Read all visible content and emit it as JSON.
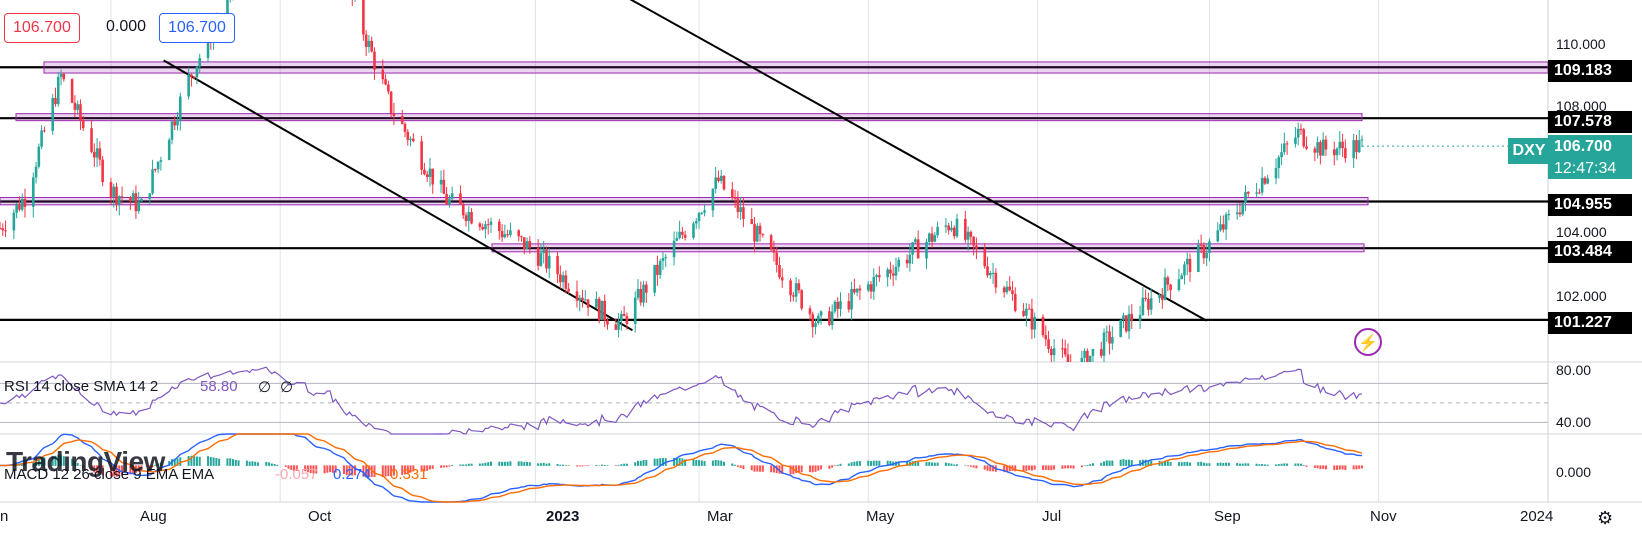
{
  "header": {
    "open_value": "106.700",
    "change_value": "0.000",
    "close_value": "106.700"
  },
  "symbol": {
    "ticker": "DXY",
    "last_price": "106.700",
    "countdown": "12:47:34"
  },
  "price_axis": {
    "ticks": [
      "110.000",
      "108.000",
      "104.000",
      "102.000"
    ]
  },
  "levels": [
    {
      "label": "109.183",
      "value": 109.183
    },
    {
      "label": "107.578",
      "value": 107.578
    },
    {
      "label": "104.955",
      "value": 104.955
    },
    {
      "label": "103.484",
      "value": 103.484
    },
    {
      "label": "101.227",
      "value": 101.227
    }
  ],
  "x_axis": {
    "labels": [
      "Aug",
      "Oct",
      "2023",
      "Mar",
      "May",
      "Jul",
      "Sep",
      "Nov",
      "2024"
    ],
    "first_label_fragment": "n"
  },
  "rsi": {
    "label": "RSI 14 close SMA 14 2",
    "value": "58.80",
    "extra1": "∅",
    "extra2": "∅",
    "axis_ticks": [
      "80.00",
      "40.00"
    ]
  },
  "macd": {
    "label": "MACD 12 26 close 9 EMA EMA",
    "histogram": "-0.057",
    "macd_value": "0.274",
    "signal_value": "0.331",
    "axis_tick": "0.000"
  },
  "branding": {
    "logo_text": "TradingView"
  },
  "colors": {
    "up": "#26a69a",
    "down": "#f23645",
    "zone": "#9c27b0",
    "rsi_line": "#7e57c2",
    "macd_line": "#2962ff",
    "signal_line": "#ff6d00"
  },
  "chart_data": {
    "type": "candlestick",
    "title": "DXY",
    "ylim": [
      99.9,
      111.3
    ],
    "x_range": [
      "2022-06",
      "2023-10"
    ],
    "close_series": [
      {
        "date": "2022-06-20",
        "value": 103.9
      },
      {
        "date": "2022-07-01",
        "value": 105.1
      },
      {
        "date": "2022-07-14",
        "value": 108.9
      },
      {
        "date": "2022-08-01",
        "value": 105.3
      },
      {
        "date": "2022-08-12",
        "value": 104.8
      },
      {
        "date": "2022-08-29",
        "value": 108.8
      },
      {
        "date": "2022-09-27",
        "value": 114.0
      },
      {
        "date": "2022-10-20",
        "value": 113.0
      },
      {
        "date": "2022-11-10",
        "value": 107.9
      },
      {
        "date": "2022-11-30",
        "value": 105.0
      },
      {
        "date": "2022-12-30",
        "value": 103.5
      },
      {
        "date": "2023-01-26",
        "value": 101.4
      },
      {
        "date": "2023-02-01",
        "value": 101.1
      },
      {
        "date": "2023-03-08",
        "value": 105.6
      },
      {
        "date": "2023-04-13",
        "value": 101.1
      },
      {
        "date": "2023-05-31",
        "value": 104.3
      },
      {
        "date": "2023-07-14",
        "value": 99.6
      },
      {
        "date": "2023-08-31",
        "value": 103.5
      },
      {
        "date": "2023-10-03",
        "value": 107.1
      },
      {
        "date": "2023-10-12",
        "value": 106.6
      },
      {
        "date": "2023-10-26",
        "value": 106.7
      }
    ],
    "zones": [
      {
        "from": 109.0,
        "to": 109.35
      },
      {
        "from": 107.5,
        "to": 107.72
      },
      {
        "from": 104.85,
        "to": 105.08
      },
      {
        "from": 103.37,
        "to": 103.62
      }
    ],
    "trendlines": [
      {
        "from": {
          "date": "2022-08-20",
          "value": 109.4
        },
        "to": {
          "date": "2023-02-05",
          "value": 100.9
        }
      },
      {
        "from": {
          "date": "2022-12-01",
          "value": 114.5
        },
        "to": {
          "date": "2023-08-31",
          "value": 101.2
        }
      }
    ],
    "rsi_ylim": [
      18,
      92
    ],
    "macd_ylim": [
      -1.4,
      1.2
    ]
  }
}
